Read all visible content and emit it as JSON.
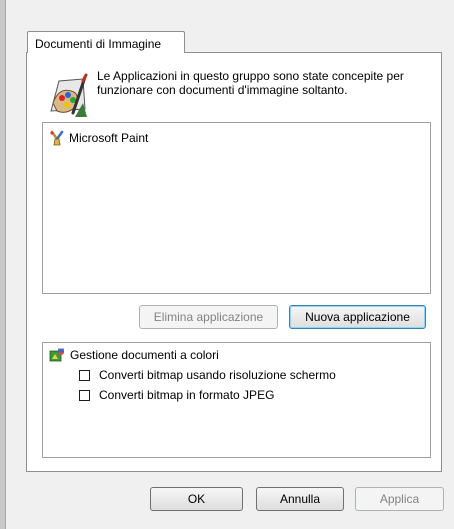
{
  "tab": {
    "label": "Documenti di Immagine"
  },
  "header": {
    "description": "Le Applicazioni in questo gruppo sono state concepite per funzionare con documenti d'immagine soltanto."
  },
  "app_list": {
    "items": [
      {
        "label": "Microsoft Paint",
        "icon": "paint-icon"
      }
    ]
  },
  "buttons": {
    "remove_app": "Elimina applicazione",
    "new_app": "Nuova applicazione",
    "ok": "OK",
    "cancel": "Annulla",
    "apply": "Applica"
  },
  "color_management": {
    "title": "Gestione documenti a colori",
    "options": [
      {
        "label": "Converti bitmap usando risoluzione schermo",
        "checked": false
      },
      {
        "label": "Converti bitmap in formato JPEG",
        "checked": false
      }
    ]
  }
}
